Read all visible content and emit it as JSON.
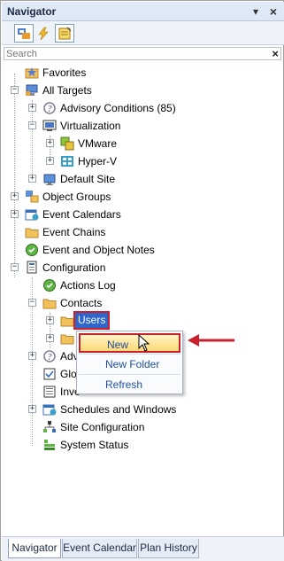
{
  "window": {
    "title": "Navigator",
    "pin_icon": "pin-icon",
    "close_icon": "close-icon"
  },
  "toolbar": {
    "buttons": [
      "tree-view-icon",
      "lightning-icon",
      "notes-icon"
    ]
  },
  "search": {
    "placeholder": "Search",
    "value": ""
  },
  "tree": {
    "favorites": "Favorites",
    "all_targets": "All Targets",
    "advisory_conditions": "Advisory Conditions (85)",
    "virtualization": "Virtualization",
    "vmware": "VMware",
    "hyperv": "Hyper-V",
    "default_site": "Default Site",
    "object_groups": "Object Groups",
    "event_calendars": "Event Calendars",
    "event_chains": "Event Chains",
    "event_notes": "Event and Object Notes",
    "configuration": "Configuration",
    "actions_log": "Actions Log",
    "contacts": "Contacts",
    "users": "Users",
    "advisory_partial": "Adv",
    "global_partial": "Glo",
    "inventory_partial": "Inve",
    "schedules": "Schedules and Windows",
    "site_configuration": "Site Configuration",
    "system_status": "System Status"
  },
  "context_menu": {
    "new": "New",
    "new_folder": "New Folder",
    "refresh": "Refresh"
  },
  "tabs": [
    "Navigator",
    "Event Calendar",
    "Plan History"
  ],
  "colors": {
    "highlight": "#2f66c9",
    "annotation": "#c8202c",
    "menu_hot": "#ffd979"
  }
}
